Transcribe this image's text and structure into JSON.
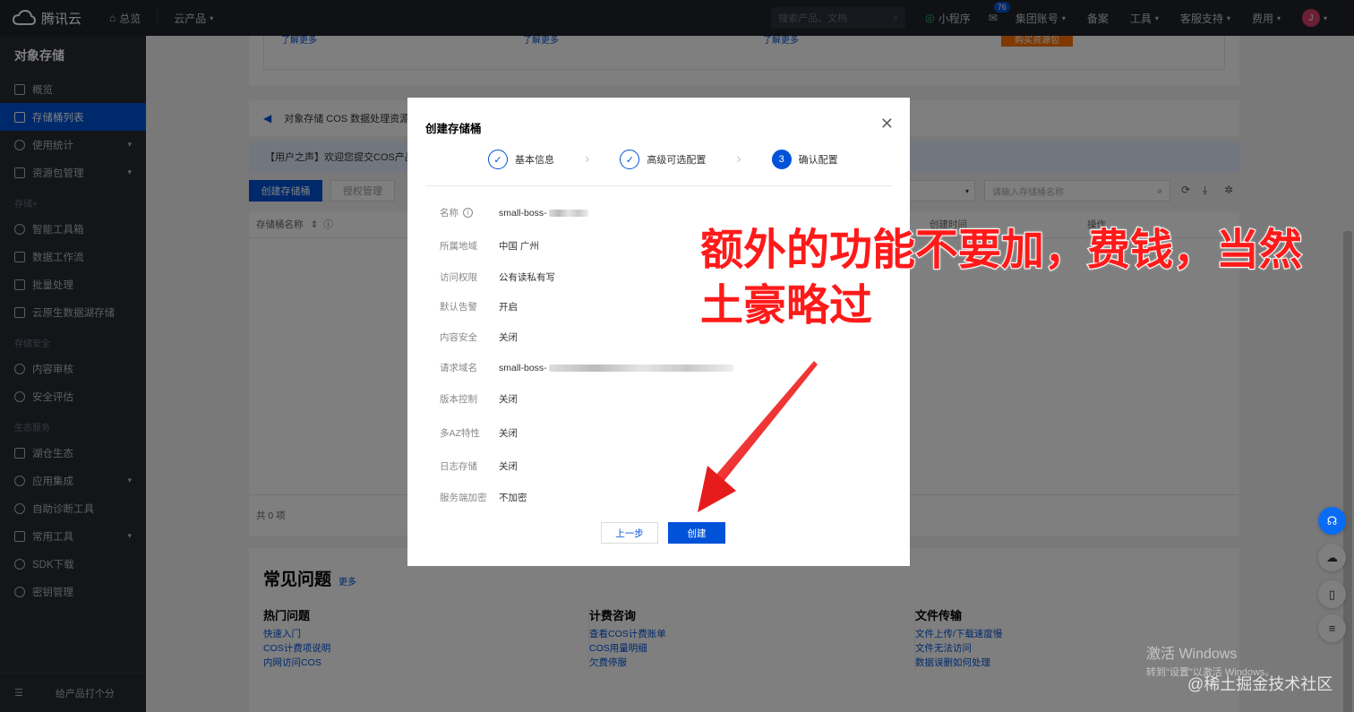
{
  "topbar": {
    "brand": "腾讯云",
    "overview": "总览",
    "products": "云产品",
    "search_placeholder": "搜索产品、文档",
    "miniapp": "小程序",
    "message_count": "76",
    "group_account": "集团账号",
    "beian": "备案",
    "tools": "工具",
    "support": "客服支持",
    "fees": "费用",
    "avatar": "J"
  },
  "sidebar": {
    "title": "对象存储",
    "items": [
      {
        "label": "概览"
      },
      {
        "label": "存储桶列表"
      },
      {
        "label": "使用统计"
      },
      {
        "label": "资源包管理"
      }
    ],
    "group_storage_plus": "存储+",
    "storage_plus_items": [
      {
        "label": "智能工具箱"
      },
      {
        "label": "数据工作流"
      },
      {
        "label": "批量处理"
      },
      {
        "label": "云原生数据湖存储"
      }
    ],
    "group_security": "存储安全",
    "security_items": [
      {
        "label": "内容审核"
      },
      {
        "label": "安全评估"
      }
    ],
    "group_eco": "生态服务",
    "eco_items": [
      {
        "label": "湖仓生态"
      },
      {
        "label": "应用集成"
      },
      {
        "label": "自助诊断工具"
      },
      {
        "label": "常用工具"
      },
      {
        "label": "SDK下载"
      },
      {
        "label": "密钥管理"
      }
    ],
    "footer_label": "给产品打个分"
  },
  "main": {
    "learn_more": "了解更多",
    "buy_pack": "购买资源包",
    "notice": "对象存储 COS 数据处理资源包",
    "user_voice": "【用户之声】欢迎您提交COS产品的...",
    "create_bucket_btn": "创建存储桶",
    "auth_btn": "授权管理",
    "bucket_search_placeholder": "请输入存储桶名称",
    "col_name": "存储桶名称",
    "col_created": "创建时间",
    "col_ops": "操作",
    "total": "共 0 项",
    "faq_title": "常见问题",
    "faq_more": "更多",
    "faq_cols": [
      {
        "title": "热门问题",
        "links": [
          "快速入门",
          "COS计费项说明",
          "内网访问COS"
        ]
      },
      {
        "title": "计费咨询",
        "links": [
          "查看COS计费账单",
          "COS用量明细",
          "欠费停服"
        ]
      },
      {
        "title": "文件传输",
        "links": [
          "文件上传/下载速度慢",
          "文件无法访问",
          "数据误删如何处理"
        ]
      }
    ]
  },
  "modal": {
    "title": "创建存储桶",
    "steps": [
      {
        "label": "基本信息",
        "number": ""
      },
      {
        "label": "高级可选配置",
        "number": ""
      },
      {
        "label": "确认配置",
        "number": "3"
      }
    ],
    "rows": [
      {
        "label": "名称",
        "value": "small-boss-"
      },
      {
        "label": "所属地域",
        "value": "中国 广州"
      },
      {
        "label": "访问权限",
        "value": "公有读私有写"
      },
      {
        "label": "默认告警",
        "value": "开启"
      },
      {
        "label": "内容安全",
        "value": "关闭"
      },
      {
        "label": "请求域名",
        "value": "small-boss-"
      },
      {
        "label": "版本控制",
        "value": "关闭"
      },
      {
        "label": "多AZ特性",
        "value": "关闭"
      },
      {
        "label": "日志存储",
        "value": "关闭"
      },
      {
        "label": "服务端加密",
        "value": "不加密"
      }
    ],
    "prev_btn": "上一步",
    "create_btn": "创建"
  },
  "annotation": {
    "line1": "额外的功能不要加，费钱，当然",
    "line2": "土豪略过",
    "color": "#ff1a1a"
  },
  "watermark": {
    "activate": "激活 Windows",
    "activate_sub": "转到\"设置\"以激活 Windows。",
    "site": "@稀土掘金技术社区"
  },
  "colors": {
    "accent": "#0052d9",
    "topbar": "#1f2329",
    "sidebar": "#262b33"
  }
}
